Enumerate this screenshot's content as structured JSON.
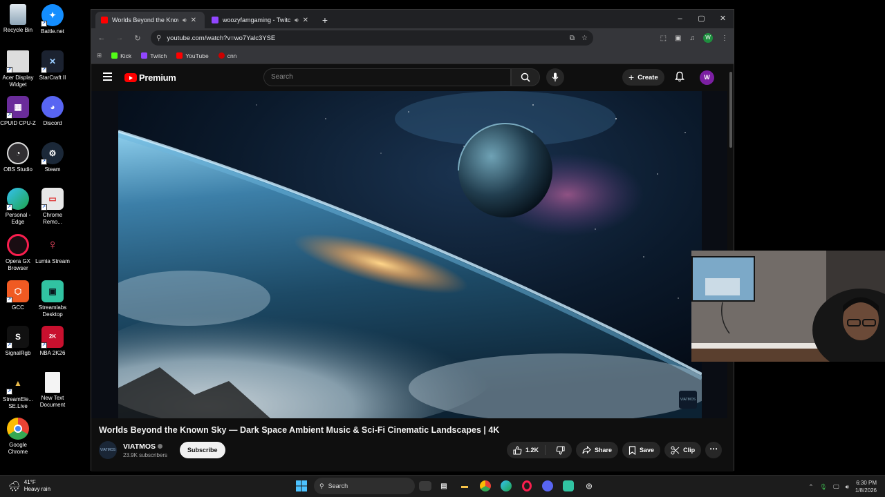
{
  "desktop_icons": [
    {
      "label": "Recycle Bin",
      "icon": "recycle-bin-icon"
    },
    {
      "label": "Battle.net",
      "icon": "battlenet-icon"
    },
    {
      "label": "Acer Display Widget",
      "icon": "acer-display-icon"
    },
    {
      "label": "StarCraft II",
      "icon": "starcraft-icon"
    },
    {
      "label": "CPUID CPU-Z",
      "icon": "cpuz-icon"
    },
    {
      "label": "Discord",
      "icon": "discord-icon"
    },
    {
      "label": "OBS Studio",
      "icon": "obs-icon"
    },
    {
      "label": "Steam",
      "icon": "steam-icon"
    },
    {
      "label": "Personal - Edge",
      "icon": "edge-icon"
    },
    {
      "label": "Chrome Remo...",
      "icon": "chrome-remote-icon"
    },
    {
      "label": "Opera GX Browser",
      "icon": "opera-gx-icon"
    },
    {
      "label": "Lumia Stream",
      "icon": "lumia-icon"
    },
    {
      "label": "GCC",
      "icon": "gcc-icon"
    },
    {
      "label": "Streamlabs Desktop",
      "icon": "streamlabs-icon"
    },
    {
      "label": "SignalRgb",
      "icon": "signalrgb-icon"
    },
    {
      "label": "NBA 2K26",
      "icon": "nba2k-icon"
    },
    {
      "label": "StreamEle... SE.Live",
      "icon": "streamelements-icon"
    },
    {
      "label": "New Text Document",
      "icon": "text-document-icon"
    },
    {
      "label": "Google Chrome",
      "icon": "chrome-icon"
    }
  ],
  "browser": {
    "tabs": [
      {
        "title": "Worlds Beyond the Known",
        "active": true
      },
      {
        "title": "woozyfamgaming - Twitch",
        "active": false
      }
    ],
    "url": "youtube.com/watch?v=wo7Yalc3YSE",
    "profile_initial": "W",
    "bookmarks": [
      "Kick",
      "Twitch",
      "YouTube",
      "cnn"
    ]
  },
  "youtube": {
    "logo_text": "Premium",
    "search_placeholder": "Search",
    "create_label": "Create",
    "avatar_initial": "W",
    "watermark": "VIATMOS",
    "video_title": "Worlds Beyond the Known Sky — Dark Space Ambient Music & Sci-Fi Cinematic Landscapes | 4K",
    "channel_name": "VIATMOS",
    "subscribers": "23.9K subscribers",
    "subscribe_label": "Subscribe",
    "likes": "1.2K",
    "share_label": "Share",
    "save_label": "Save",
    "clip_label": "Clip"
  },
  "taskbar": {
    "temperature": "41°F",
    "weather": "Heavy rain",
    "search_label": "Search",
    "time": "6:30 PM",
    "date": "1/8/2026"
  }
}
